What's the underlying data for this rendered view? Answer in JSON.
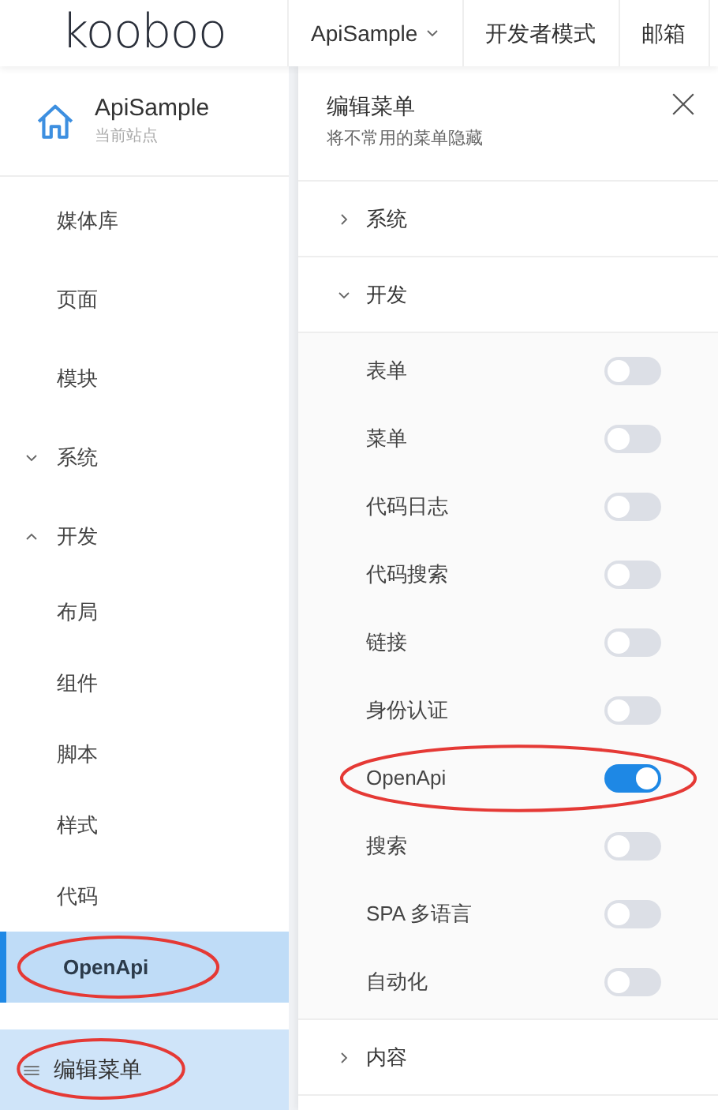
{
  "header": {
    "logo": "kooboo",
    "nav": [
      {
        "label": "ApiSample",
        "kind": "dropdown"
      },
      {
        "label": "开发者模式",
        "kind": "link"
      },
      {
        "label": "邮箱",
        "kind": "link"
      }
    ]
  },
  "sidebar": {
    "site": {
      "name": "ApiSample",
      "caption": "当前站点"
    },
    "items": [
      {
        "label": "媒体库",
        "selected": false
      },
      {
        "label": "页面",
        "selected": false
      },
      {
        "label": "模块",
        "selected": false
      },
      {
        "label": "系统",
        "selected": false,
        "expanded": false
      },
      {
        "label": "开发",
        "selected": false,
        "expanded": true,
        "children": [
          {
            "label": "布局",
            "selected": false,
            "annotated": false
          },
          {
            "label": "组件",
            "selected": false,
            "annotated": false
          },
          {
            "label": "脚本",
            "selected": false,
            "annotated": false
          },
          {
            "label": "样式",
            "selected": false,
            "annotated": false
          },
          {
            "label": "代码",
            "selected": false,
            "annotated": false
          },
          {
            "label": "OpenApi",
            "selected": true,
            "annotated": true
          }
        ]
      }
    ],
    "edit_button": {
      "label": "编辑菜单",
      "annotated": true
    }
  },
  "panel": {
    "title": "编辑菜单",
    "subtitle": "将不常用的菜单隐藏",
    "groups": [
      {
        "label": "系统",
        "expanded": false
      },
      {
        "label": "开发",
        "expanded": true,
        "items": [
          {
            "label": "表单",
            "on": false,
            "annotated": false
          },
          {
            "label": "菜单",
            "on": false,
            "annotated": false
          },
          {
            "label": "代码日志",
            "on": false,
            "annotated": false
          },
          {
            "label": "代码搜索",
            "on": false,
            "annotated": false
          },
          {
            "label": "链接",
            "on": false,
            "annotated": false
          },
          {
            "label": "身份认证",
            "on": false,
            "annotated": false
          },
          {
            "label": "OpenApi",
            "on": true,
            "annotated": true
          },
          {
            "label": "搜索",
            "on": false,
            "annotated": false
          },
          {
            "label": "SPA 多语言",
            "on": false,
            "annotated": false
          },
          {
            "label": "自动化",
            "on": false,
            "annotated": false
          }
        ]
      },
      {
        "label": "内容",
        "expanded": false
      }
    ]
  }
}
